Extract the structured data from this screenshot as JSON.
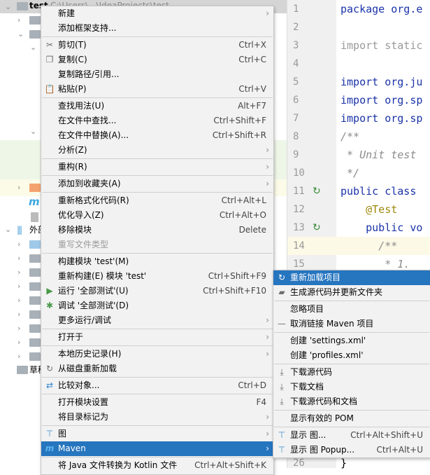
{
  "project_tree": {
    "root_label": "test",
    "root_path": "C:\\Users\\...\\IdeaProjects\\test",
    "external_libs_label": "外部",
    "scratches_label": "草稿"
  },
  "editor": {
    "lines": [
      {
        "n": "1",
        "text": "package org.e",
        "style": "kw"
      },
      {
        "n": "2",
        "text": "",
        "style": ""
      },
      {
        "n": "3",
        "text": "import static",
        "style": "cm0"
      },
      {
        "n": "4",
        "text": "",
        "style": ""
      },
      {
        "n": "5",
        "text": "import org.ju",
        "style": "kw"
      },
      {
        "n": "6",
        "text": "import org.sp",
        "style": "kw"
      },
      {
        "n": "7",
        "text": "import org.sp",
        "style": "kw"
      },
      {
        "n": "8",
        "text": "/**",
        "style": "cm"
      },
      {
        "n": "9",
        "text": " * Unit test",
        "style": "cm"
      },
      {
        "n": "10",
        "text": " */",
        "style": "cm"
      },
      {
        "n": "11",
        "text": "public class",
        "style": "kw"
      },
      {
        "n": "12",
        "text": "    @Test",
        "style": "an"
      },
      {
        "n": "13",
        "text": "    public vo",
        "style": "kw"
      },
      {
        "n": "14",
        "text": "      /**",
        "style": "cm"
      },
      {
        "n": "15",
        "text": "       * 1.",
        "style": "cm"
      }
    ],
    "last_line": {
      "n": "26",
      "text": "}"
    }
  },
  "context_menu": {
    "groups": [
      [
        {
          "label": "新建",
          "submenu": true
        },
        {
          "label": "添加框架支持..."
        }
      ],
      [
        {
          "label": "剪切(T)",
          "shortcut": "Ctrl+X",
          "icon": "scissors-icon"
        },
        {
          "label": "复制(C)",
          "shortcut": "Ctrl+C",
          "icon": "copy-icon"
        },
        {
          "label": "复制路径/引用..."
        },
        {
          "label": "粘贴(P)",
          "shortcut": "Ctrl+V",
          "icon": "paste-icon"
        }
      ],
      [
        {
          "label": "查找用法(U)",
          "shortcut": "Alt+F7"
        },
        {
          "label": "在文件中查找...",
          "shortcut": "Ctrl+Shift+F"
        },
        {
          "label": "在文件中替换(A)...",
          "shortcut": "Ctrl+Shift+R"
        },
        {
          "label": "分析(Z)",
          "submenu": true
        }
      ],
      [
        {
          "label": "重构(R)",
          "submenu": true
        }
      ],
      [
        {
          "label": "添加到收藏夹(A)",
          "submenu": true
        }
      ],
      [
        {
          "label": "重新格式化代码(R)",
          "shortcut": "Ctrl+Alt+L"
        },
        {
          "label": "优化导入(Z)",
          "shortcut": "Ctrl+Alt+O"
        },
        {
          "label": "移除模块",
          "shortcut": "Delete"
        },
        {
          "label": "重写文件类型",
          "disabled": true
        }
      ],
      [
        {
          "label": "构建模块 'test'(M)"
        },
        {
          "label": "重新构建(E) 模块 'test'",
          "shortcut": "Ctrl+Shift+F9"
        },
        {
          "label": "运行 '全部测试'(U)",
          "shortcut": "Ctrl+Shift+F10",
          "icon": "run-icon"
        },
        {
          "label": "调试 '全部测试'(D)",
          "icon": "debug-icon"
        },
        {
          "label": "更多运行/调试",
          "submenu": true
        }
      ],
      [
        {
          "label": "打开于",
          "submenu": true
        }
      ],
      [
        {
          "label": "本地历史记录(H)",
          "submenu": true
        },
        {
          "label": "从磁盘重新加载",
          "icon": "reload-icon"
        }
      ],
      [
        {
          "label": "比较对象...",
          "shortcut": "Ctrl+D",
          "icon": "compare-icon"
        }
      ],
      [
        {
          "label": "打开模块设置",
          "shortcut": "F4"
        },
        {
          "label": "将目录标记为",
          "submenu": true
        }
      ],
      [
        {
          "label": "图",
          "submenu": true,
          "icon": "diagram-icon"
        },
        {
          "label": "Maven",
          "submenu": true,
          "icon": "maven-icon",
          "selected": true
        }
      ],
      [
        {
          "label": "将 Java 文件转换为 Kotlin 文件",
          "shortcut": "Ctrl+Alt+Shift+K"
        }
      ]
    ]
  },
  "maven_submenu": {
    "groups": [
      [
        {
          "label": "重新加载项目",
          "icon": "reload-icon",
          "selected": true
        },
        {
          "label": "生成源代码并更新文件夹",
          "icon": "folder-refresh-icon"
        }
      ],
      [
        {
          "label": "忽略项目"
        },
        {
          "label": "取消链接 Maven 项目",
          "icon": "minus-icon"
        }
      ],
      [
        {
          "label": "创建 'settings.xml'"
        },
        {
          "label": "创建 'profiles.xml'"
        }
      ],
      [
        {
          "label": "下载源代码",
          "icon": "download-icon"
        },
        {
          "label": "下载文档",
          "icon": "download-icon"
        },
        {
          "label": "下载源代码和文档",
          "icon": "download-icon"
        }
      ],
      [
        {
          "label": "显示有效的 POM"
        }
      ],
      [
        {
          "label": "显示 图...",
          "shortcut": "Ctrl+Alt+Shift+U",
          "icon": "diagram-icon"
        },
        {
          "label": "显示 图 Popup...",
          "shortcut": "Ctrl+Alt+U",
          "icon": "diagram-icon"
        }
      ]
    ]
  },
  "colors": {
    "selection": "#2675bf",
    "menu_bg": "#f2f2f2",
    "gutter": "#f0f0f0",
    "keyword": "#1a33a8"
  }
}
